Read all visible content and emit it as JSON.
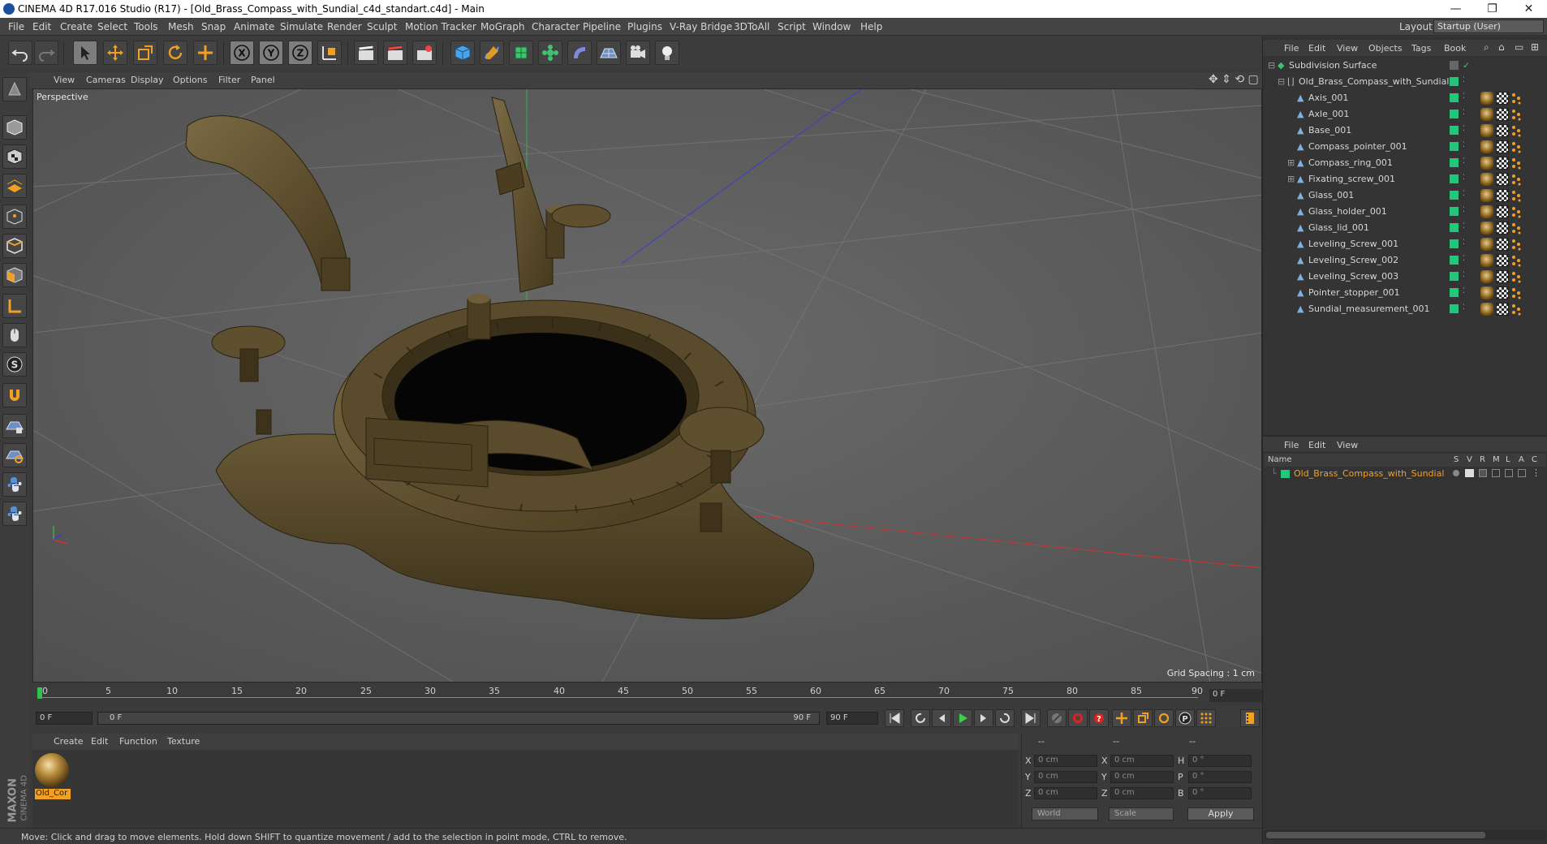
{
  "window": {
    "title": "CINEMA 4D R17.016 Studio (R17) - [Old_Brass_Compass_with_Sundial_c4d_standart.c4d] - Main",
    "minimize": "—",
    "restore": "❐",
    "close": "✕"
  },
  "menubar": {
    "items": [
      "File",
      "Edit",
      "Create",
      "Select",
      "Tools",
      "Mesh",
      "Snap",
      "Animate",
      "Simulate",
      "Render",
      "Sculpt",
      "Motion Tracker",
      "MoGraph",
      "Character",
      "Pipeline",
      "Plugins",
      "V-Ray Bridge",
      "3DToAll",
      "Script",
      "Window",
      "Help"
    ],
    "layout_label": "Layout:",
    "layout_value": "Startup (User)"
  },
  "viewport": {
    "menu": [
      "View",
      "Cameras",
      "Display",
      "Options",
      "Filter",
      "Panel"
    ],
    "camera_label": "Perspective",
    "grid_spacing": "Grid Spacing : 1 cm"
  },
  "timeline": {
    "ticks": [
      "0",
      "5",
      "10",
      "15",
      "20",
      "25",
      "30",
      "35",
      "40",
      "45",
      "50",
      "55",
      "60",
      "65",
      "70",
      "75",
      "80",
      "85",
      "90"
    ],
    "current_frame": "0 F",
    "start_field": "0 F",
    "range_start": "0 F",
    "range_end": "90 F",
    "end_field": "90 F"
  },
  "material_manager": {
    "menu": [
      "Create",
      "Edit",
      "Function",
      "Texture"
    ],
    "materials": [
      {
        "name": "Old_Cor"
      }
    ]
  },
  "coordinates": {
    "header": [
      "--",
      "--",
      "--"
    ],
    "rows": [
      {
        "axis": "X",
        "pos": "0 cm",
        "size_axis": "X",
        "size": "0 cm",
        "rot_axis": "H",
        "rot": "0 °"
      },
      {
        "axis": "Y",
        "pos": "0 cm",
        "size_axis": "Y",
        "size": "0 cm",
        "rot_axis": "P",
        "rot": "0 °"
      },
      {
        "axis": "Z",
        "pos": "0 cm",
        "size_axis": "Z",
        "size": "0 cm",
        "rot_axis": "B",
        "rot": "0 °"
      }
    ],
    "mode": "World",
    "scale_mode": "Scale",
    "apply": "Apply"
  },
  "status": {
    "text": "Move: Click and drag to move elements. Hold down SHIFT to quantize movement / add to the selection in point mode, CTRL to remove."
  },
  "brand": {
    "maxon": "MAXON",
    "cinema": "CINEMA 4D"
  },
  "object_manager": {
    "menu": [
      "File",
      "Edit",
      "View",
      "Objects",
      "Tags",
      "Book"
    ],
    "root": "Subdivision Surface",
    "group": "Old_Brass_Compass_with_Sundial",
    "objects": [
      "Axis_001",
      "Axle_001",
      "Base_001",
      "Compass_pointer_001",
      "Compass_ring_001",
      "Fixating_screw_001",
      "Glass_001",
      "Glass_holder_001",
      "Glass_lid_001",
      "Leveling_Screw_001",
      "Leveling_Screw_002",
      "Leveling_Screw_003",
      "Pointer_stopper_001",
      "Sundial_measurement_001"
    ],
    "expandable": [
      "Compass_ring_001",
      "Fixating_screw_001"
    ]
  },
  "attribute_manager": {
    "menu": [
      "File",
      "Edit",
      "View"
    ],
    "columns": [
      "Name",
      "S",
      "V",
      "R",
      "M",
      "L",
      "A",
      "C"
    ],
    "row_name": "Old_Brass_Compass_with_Sundial"
  },
  "colors": {
    "accent_orange": "#f2a024",
    "object_green": "#23c77a",
    "viewport_bg": "#5f5f5f",
    "brass": "#5a4a2a"
  }
}
